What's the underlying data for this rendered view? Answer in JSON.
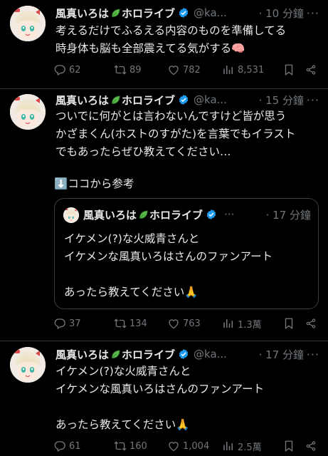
{
  "colors": {
    "background": "#000000",
    "text": "#e7e9ea",
    "muted": "#71767b",
    "verified": "#1d9bf0",
    "divider": "#2f3336"
  },
  "tweets": [
    {
      "name": "風真いろは",
      "name_suffix": "ホロライブ",
      "handle": "@ka...",
      "time": "· 10 分鐘",
      "more": "···",
      "text": "考えるだけでふるえる内容のものを準備してる\n時身体も脳も全部震えてる気がする🧠",
      "replies": "62",
      "retweets": "89",
      "likes": "782",
      "views": "8,531"
    },
    {
      "name": "風真いろは",
      "name_suffix": "ホロライブ",
      "handle": "@ka...",
      "time": "· 15 分鐘",
      "more": "···",
      "text": "ついでに何がとは言わないんですけど皆が思う\nかざまくん(ホストのすがた)を言葉でもイラスト\nでもあったらぜひ教えてください…",
      "pointer_icon": "⬇️",
      "pointer_text": "ココから参考",
      "quote": {
        "name": "風真いろは",
        "name_suffix": "ホロライブ",
        "more": "···",
        "time": "· 17 分鐘",
        "text": "イケメン(?)な火威青さんと\nイケメンな風真いろはさんのファンアート\n\nあったら教えてください🙏"
      },
      "replies": "37",
      "retweets": "134",
      "likes": "763",
      "views": "1.3萬"
    },
    {
      "name": "風真いろは",
      "name_suffix": "ホロライブ",
      "handle": "@ka...",
      "time": "· 17 分鐘",
      "more": "···",
      "text": "イケメン(?)な火威青さんと\nイケメンな風真いろはさんのファンアート\n\nあったら教えてください🙏",
      "replies": "61",
      "retweets": "160",
      "likes": "1,004",
      "views": "2.5萬"
    }
  ]
}
